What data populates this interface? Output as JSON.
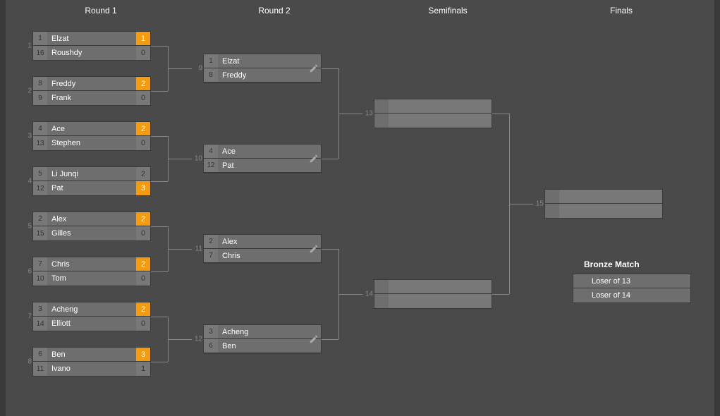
{
  "headers": [
    "Round 1",
    "Round 2",
    "Semifinals",
    "Finals"
  ],
  "bronze_label": "Bronze Match",
  "round1": [
    {
      "num": "1",
      "p1": {
        "seed": "1",
        "name": "Elzat",
        "score": "1",
        "win": true
      },
      "p2": {
        "seed": "16",
        "name": "Roushdy",
        "score": "0",
        "win": false
      }
    },
    {
      "num": "2",
      "p1": {
        "seed": "8",
        "name": "Freddy",
        "score": "2",
        "win": true
      },
      "p2": {
        "seed": "9",
        "name": "Frank",
        "score": "0",
        "win": false
      }
    },
    {
      "num": "3",
      "p1": {
        "seed": "4",
        "name": "Ace",
        "score": "2",
        "win": true
      },
      "p2": {
        "seed": "13",
        "name": "Stephen",
        "score": "0",
        "win": false
      }
    },
    {
      "num": "4",
      "p1": {
        "seed": "5",
        "name": "Li Junqi",
        "score": "2",
        "win": false
      },
      "p2": {
        "seed": "12",
        "name": "Pat",
        "score": "3",
        "win": true
      }
    },
    {
      "num": "5",
      "p1": {
        "seed": "2",
        "name": "Alex",
        "score": "2",
        "win": true
      },
      "p2": {
        "seed": "15",
        "name": "Gilles",
        "score": "0",
        "win": false
      }
    },
    {
      "num": "6",
      "p1": {
        "seed": "7",
        "name": "Chris",
        "score": "2",
        "win": true
      },
      "p2": {
        "seed": "10",
        "name": "Tom",
        "score": "0",
        "win": false
      }
    },
    {
      "num": "7",
      "p1": {
        "seed": "3",
        "name": "Acheng",
        "score": "2",
        "win": true
      },
      "p2": {
        "seed": "14",
        "name": "Elliott",
        "score": "0",
        "win": false
      }
    },
    {
      "num": "8",
      "p1": {
        "seed": "6",
        "name": "Ben",
        "score": "3",
        "win": true
      },
      "p2": {
        "seed": "11",
        "name": "Ivano",
        "score": "1",
        "win": false
      }
    }
  ],
  "round2": [
    {
      "num": "9",
      "p1": {
        "seed": "1",
        "name": "Elzat"
      },
      "p2": {
        "seed": "8",
        "name": "Freddy"
      }
    },
    {
      "num": "10",
      "p1": {
        "seed": "4",
        "name": "Ace"
      },
      "p2": {
        "seed": "12",
        "name": "Pat"
      }
    },
    {
      "num": "11",
      "p1": {
        "seed": "2",
        "name": "Alex"
      },
      "p2": {
        "seed": "7",
        "name": "Chris"
      }
    },
    {
      "num": "12",
      "p1": {
        "seed": "3",
        "name": "Acheng"
      },
      "p2": {
        "seed": "6",
        "name": "Ben"
      }
    }
  ],
  "semis": [
    {
      "num": "13",
      "p1": {
        "name": ""
      },
      "p2": {
        "name": ""
      }
    },
    {
      "num": "14",
      "p1": {
        "name": ""
      },
      "p2": {
        "name": ""
      }
    }
  ],
  "finals": {
    "num": "15",
    "p1": {
      "name": ""
    },
    "p2": {
      "name": ""
    }
  },
  "bronze": {
    "p1": {
      "name": "Loser of 13"
    },
    "p2": {
      "name": "Loser of 14"
    }
  }
}
